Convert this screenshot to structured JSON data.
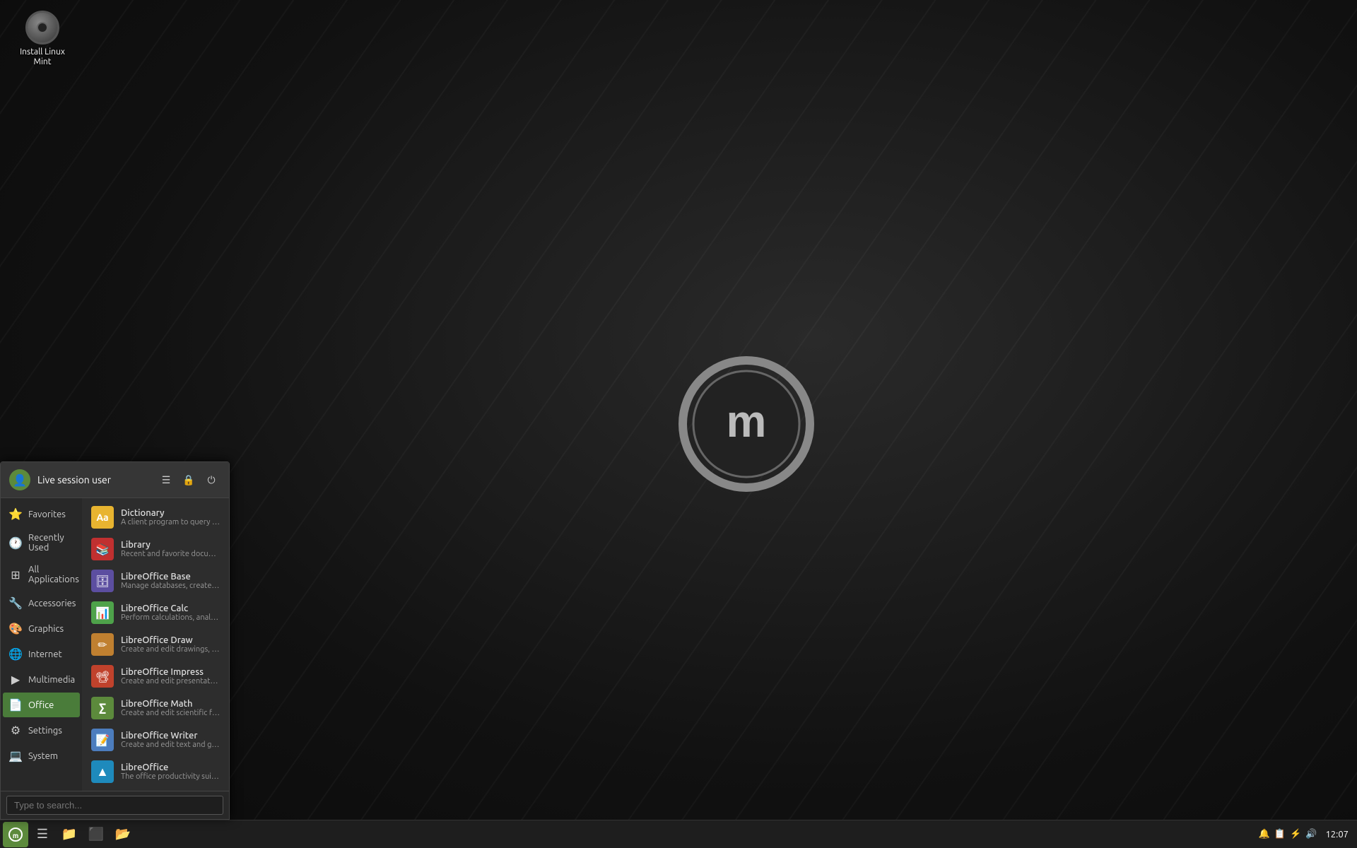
{
  "desktop": {
    "icon": {
      "label": "Install Linux\nMint",
      "line1": "Install Linux",
      "line2": "Mint"
    }
  },
  "taskbar": {
    "time": "12:07",
    "buttons": [
      {
        "name": "mint-menu",
        "icon": "🌿"
      },
      {
        "name": "folder-home",
        "icon": "🗂️"
      },
      {
        "name": "folder-yellow",
        "icon": "📁"
      },
      {
        "name": "terminal",
        "icon": "⬛"
      },
      {
        "name": "folder2",
        "icon": "📂"
      }
    ],
    "tray": {
      "notification": "🔔",
      "clipboard": "📋",
      "power": "⚡",
      "volume": "🔊",
      "time": "12:07"
    }
  },
  "menu": {
    "header": {
      "user_name": "Live session user",
      "icons": [
        "files",
        "lock",
        "power"
      ]
    },
    "categories": [
      {
        "id": "favorites",
        "label": "Favorites",
        "icon": "⭐"
      },
      {
        "id": "recently-used",
        "label": "Recently Used",
        "icon": "🕐"
      },
      {
        "id": "all-applications",
        "label": "All Applications",
        "icon": "⊞"
      },
      {
        "id": "accessories",
        "label": "Accessories",
        "icon": "🔧"
      },
      {
        "id": "graphics",
        "label": "Graphics",
        "icon": "🎨"
      },
      {
        "id": "internet",
        "label": "Internet",
        "icon": "🌐"
      },
      {
        "id": "multimedia",
        "label": "Multimedia",
        "icon": "▶"
      },
      {
        "id": "office",
        "label": "Office",
        "icon": "📄"
      },
      {
        "id": "settings",
        "label": "Settings",
        "icon": "⚙"
      },
      {
        "id": "system",
        "label": "System",
        "icon": "💻"
      }
    ],
    "apps": [
      {
        "name": "Dictionary",
        "desc": "A client program to query different dic...",
        "icon_class": "dict-icon",
        "icon_text": "Aa"
      },
      {
        "name": "Library",
        "desc": "Recent and favorite documents",
        "icon_class": "lib-icon",
        "icon_text": "📚"
      },
      {
        "name": "LibreOffice Base",
        "desc": "Manage databases, create queries and ...",
        "icon_class": "lo-base",
        "icon_text": "🗄"
      },
      {
        "name": "LibreOffice Calc",
        "desc": "Perform calculations, analyze informati...",
        "icon_class": "lo-calc",
        "icon_text": "📊"
      },
      {
        "name": "LibreOffice Draw",
        "desc": "Create and edit drawings, flow charts a...",
        "icon_class": "lo-draw",
        "icon_text": "✏"
      },
      {
        "name": "LibreOffice Impress",
        "desc": "Create and edit presentations for slide...",
        "icon_class": "lo-impress",
        "icon_text": "📽"
      },
      {
        "name": "LibreOffice Math",
        "desc": "Create and edit scientific formulas and ...",
        "icon_class": "lo-math",
        "icon_text": "∑"
      },
      {
        "name": "LibreOffice Writer",
        "desc": "Create and edit text and graphics in let...",
        "icon_class": "lo-writer",
        "icon_text": "📝"
      },
      {
        "name": "LibreOffice",
        "desc": "The office productivity suite compatibil...",
        "icon_class": "lo-main",
        "icon_text": "▲"
      }
    ],
    "search_placeholder": "Type to search..."
  }
}
